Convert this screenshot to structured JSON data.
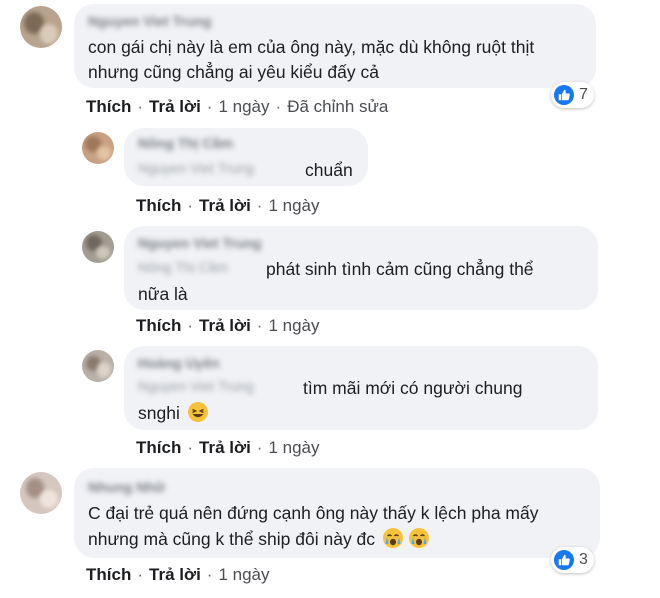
{
  "actions": {
    "like": "Thích",
    "reply": "Trả lời",
    "dot": "·"
  },
  "comments": [
    {
      "author": "Nguyen Viet Trung",
      "text_lines": [
        "con gái chị này là em của ông này, mặc dù không ruột thịt",
        "nhưng cũng chẳng ai yêu kiểu đấy cả"
      ],
      "time": "1 ngày",
      "edited": "Đã chỉnh sửa",
      "reactions": "7"
    },
    {
      "author": "Nông Thị Cầm",
      "mention": "Nguyen Viet Trung",
      "text_lines": [
        "chuẩn"
      ],
      "time": "1 ngày"
    },
    {
      "author": "Nguyen Viet Trung",
      "mention": "Nông Thị Cầm",
      "text_lines": [
        "phát sinh tình cảm cũng chẳng thể",
        "nữa là"
      ],
      "time": "1 ngày"
    },
    {
      "author": "Hoàng Uyên",
      "mention": "Nguyen Viet Trung",
      "text_lines": [
        "tìm mãi mới có người chung",
        "snghi"
      ],
      "emoji": "laughing-emoji",
      "time": "1 ngày"
    },
    {
      "author": "Nhung Nhữ",
      "text_lines": [
        "C đại trẻ quá nên đứng cạnh ông này thấy k lệch pha mấy",
        "nhưng mà cũng k thể ship đôi này đc"
      ],
      "emoji": "crying-emoji",
      "time": "1 ngày",
      "reactions": "3"
    }
  ],
  "colors": {
    "bubble": "#f0f2f5",
    "like_blue": "#1877f2",
    "text": "#1c1e21"
  }
}
